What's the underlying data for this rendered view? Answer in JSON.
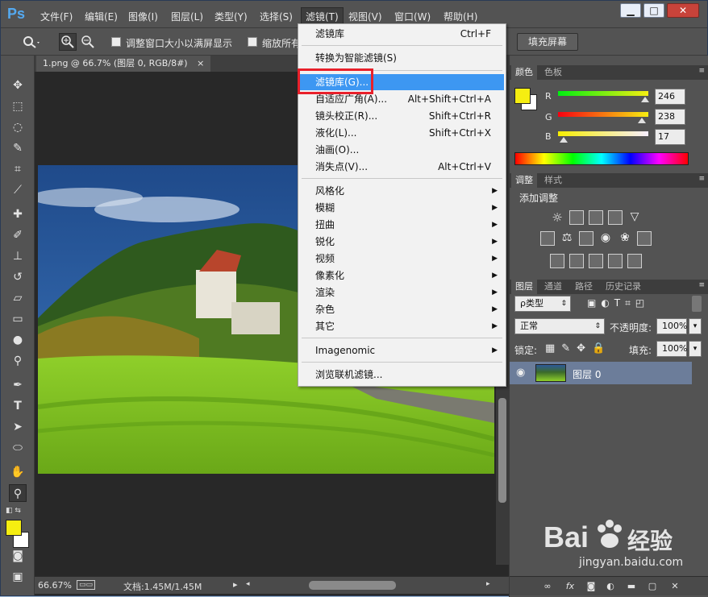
{
  "app": {
    "logo": "Ps"
  },
  "menubar": {
    "items": [
      "文件(F)",
      "编辑(E)",
      "图像(I)",
      "图层(L)",
      "类型(Y)",
      "选择(S)",
      "滤镜(T)",
      "视图(V)",
      "窗口(W)",
      "帮助(H)"
    ]
  },
  "window_controls": {
    "minimize": "▁",
    "restore": "□",
    "close": "✕"
  },
  "options": {
    "resize_windows": "调整窗口大小以满屏显示",
    "zoom_all": "缩放所有",
    "fill_screen": "填充屏幕"
  },
  "document": {
    "tab_title": "1.png @ 66.7% (图层 0, RGB/8#)",
    "tab_close": "×",
    "zoom": "66.67%",
    "doc_info": "文档:1.45M/1.45M",
    "status_arrow": "▸"
  },
  "filter_menu": {
    "items": [
      {
        "label": "滤镜库",
        "shortcut": "Ctrl+F"
      },
      {
        "label": "转换为智能滤镜(S)",
        "shortcut": ""
      },
      {
        "label": "滤镜库(G)...",
        "shortcut": ""
      },
      {
        "label": "自适应广角(A)...",
        "shortcut": "Alt+Shift+Ctrl+A"
      },
      {
        "label": "镜头校正(R)...",
        "shortcut": "Shift+Ctrl+R"
      },
      {
        "label": "液化(L)...",
        "shortcut": "Shift+Ctrl+X"
      },
      {
        "label": "油画(O)...",
        "shortcut": ""
      },
      {
        "label": "消失点(V)...",
        "shortcut": "Alt+Ctrl+V"
      },
      {
        "label": "风格化",
        "shortcut": ""
      },
      {
        "label": "模糊",
        "shortcut": ""
      },
      {
        "label": "扭曲",
        "shortcut": ""
      },
      {
        "label": "锐化",
        "shortcut": ""
      },
      {
        "label": "视频",
        "shortcut": ""
      },
      {
        "label": "像素化",
        "shortcut": ""
      },
      {
        "label": "渲染",
        "shortcut": ""
      },
      {
        "label": "杂色",
        "shortcut": ""
      },
      {
        "label": "其它",
        "shortcut": ""
      },
      {
        "label": "Imagenomic",
        "shortcut": ""
      },
      {
        "label": "浏览联机滤镜...",
        "shortcut": ""
      }
    ],
    "submenu_arrow": "▶",
    "highlighted": "滤镜库(G)..."
  },
  "color_panel": {
    "tabs": [
      "颜色",
      "色板"
    ],
    "channels": [
      {
        "label": "R",
        "value": "246"
      },
      {
        "label": "G",
        "value": "238"
      },
      {
        "label": "B",
        "value": "17"
      }
    ],
    "foreground": "#f6ee11",
    "background": "#ffffff"
  },
  "adjustments_panel": {
    "tabs": [
      "调整",
      "样式"
    ],
    "title": "添加调整"
  },
  "layers_panel": {
    "tabs": [
      "图层",
      "通道",
      "路径",
      "历史记录"
    ],
    "kind_filter": "ρ类型",
    "blend_mode": "正常",
    "opacity_label": "不透明度:",
    "opacity": "100%",
    "lock_label": "锁定:",
    "fill_label": "填充:",
    "fill": "100%",
    "layer_name": "图层 0"
  },
  "watermark": {
    "brand": "Bai",
    "brand_suffix": "经验",
    "url": "jingyan.baidu.com"
  }
}
